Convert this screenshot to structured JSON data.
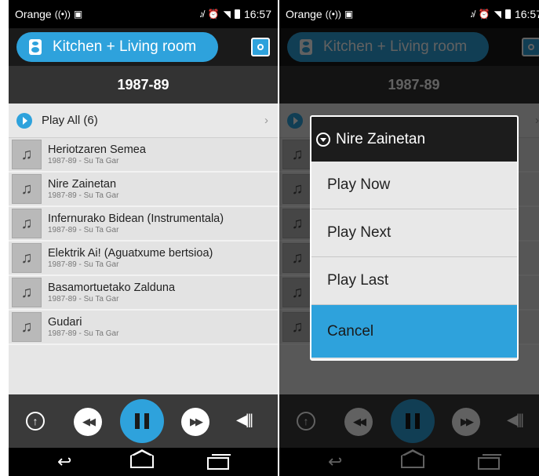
{
  "status": {
    "carrier": "Orange",
    "time": "16:57"
  },
  "room": {
    "label": "Kitchen + Living room"
  },
  "album": {
    "title": "1987-89"
  },
  "play_all": {
    "label": "Play All (6)"
  },
  "tracks": [
    {
      "title": "Heriotzaren Semea",
      "subtitle": "1987-89 - Su Ta Gar"
    },
    {
      "title": "Nire Zainetan",
      "subtitle": "1987-89 - Su Ta Gar"
    },
    {
      "title": "Infernurako Bidean (Instrumentala)",
      "subtitle": "1987-89 - Su Ta Gar"
    },
    {
      "title": "Elektrik Ai! (Aguatxume bertsioa)",
      "subtitle": "1987-89 - Su Ta Gar"
    },
    {
      "title": "Basamortuetako Zalduna",
      "subtitle": "1987-89 - Su Ta Gar"
    },
    {
      "title": "Gudari",
      "subtitle": "1987-89 - Su Ta Gar"
    }
  ],
  "dialog": {
    "title": "Nire Zainetan",
    "items": [
      "Play Now",
      "Play Next",
      "Play Last"
    ],
    "cancel": "Cancel"
  },
  "icons": {
    "accent": "#2ea2dc",
    "player": [
      "up-arrow-icon",
      "previous-icon",
      "pause-icon",
      "next-icon",
      "volume-icon"
    ]
  }
}
